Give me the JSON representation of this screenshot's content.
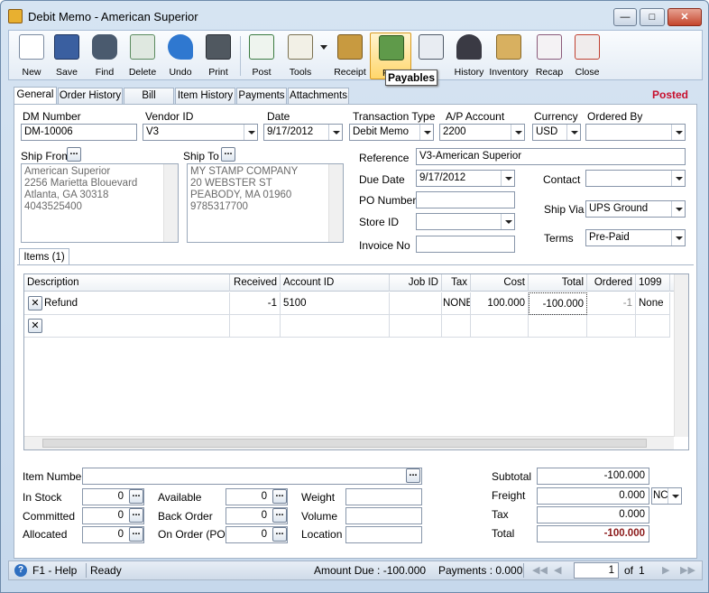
{
  "window": {
    "title": "Debit Memo - American Superior",
    "posted": "Posted"
  },
  "toolbar": {
    "buttons": [
      {
        "label": "New",
        "icon": "new-document-icon"
      },
      {
        "label": "Save",
        "icon": "save-icon"
      },
      {
        "label": "Find",
        "icon": "binoculars-icon"
      },
      {
        "label": "Delete",
        "icon": "recycle-bin-icon"
      },
      {
        "label": "Undo",
        "icon": "undo-icon"
      },
      {
        "label": "Print",
        "icon": "printer-icon"
      },
      {
        "label": "Post",
        "icon": "post-icon"
      },
      {
        "label": "Tools",
        "icon": "tools-icon"
      },
      {
        "label": "Receipt",
        "icon": "receipt-icon"
      },
      {
        "label": "Payables",
        "icon": "payables-icon"
      },
      {
        "label": "",
        "icon": "pen-icon"
      },
      {
        "label": "History",
        "icon": "history-icon"
      },
      {
        "label": "Inventory",
        "icon": "inventory-icon"
      },
      {
        "label": "Recap",
        "icon": "recap-icon"
      },
      {
        "label": "Close",
        "icon": "close-icon"
      }
    ],
    "payables_short": "Pay",
    "tooltip": "Payables"
  },
  "tabs": [
    "General",
    "Order History",
    "Bill History",
    "Item History",
    "Payments",
    "Attachments"
  ],
  "header": {
    "dm_number_label": "DM Number",
    "dm_number": "DM-10006",
    "vendor_id_label": "Vendor ID",
    "vendor_id": "V3",
    "date_label": "Date",
    "date": "9/17/2012",
    "transaction_type_label": "Transaction Type",
    "transaction_type": "Debit Memo",
    "ap_account_label": "A/P Account",
    "ap_account": "2200",
    "currency_label": "Currency",
    "currency": "USD",
    "ordered_by_label": "Ordered By",
    "ordered_by": ""
  },
  "ship_from": {
    "label": "Ship From",
    "lines": [
      "American Superior",
      "2256 Marietta Blouevard",
      "Atlanta, GA 30318",
      "4043525400"
    ]
  },
  "ship_to": {
    "label": "Ship To",
    "lines": [
      "MY STAMP COMPANY",
      "20 WEBSTER ST",
      "PEABODY, MA 01960",
      "9785317700"
    ]
  },
  "details": {
    "reference_label": "Reference",
    "reference": "V3-American Superior",
    "due_date_label": "Due Date",
    "due_date": "9/17/2012",
    "po_number_label": "PO Number",
    "po_number": "",
    "store_id_label": "Store ID",
    "store_id": "",
    "invoice_no_label": "Invoice No",
    "invoice_no": "",
    "contact_label": "Contact",
    "contact": "",
    "ship_via_label": "Ship Via",
    "ship_via": "UPS Ground",
    "terms_label": "Terms",
    "terms": "Pre-Paid"
  },
  "items": {
    "tab_label": "Items (1)",
    "columns": [
      "Description",
      "Received",
      "Account ID",
      "Job ID",
      "Tax",
      "Cost",
      "Total",
      "Ordered",
      "1099"
    ],
    "rows": [
      {
        "description": "Refund",
        "received": "-1",
        "account_id": "5100",
        "job_id": "",
        "tax": "NONE",
        "cost": "100.000",
        "total": "-100.000",
        "ordered": "-1",
        "form_1099": "None"
      }
    ]
  },
  "stock": {
    "item_number_label": "Item Number",
    "item_number": "",
    "in_stock_label": "In Stock",
    "in_stock": "0",
    "committed_label": "Committed",
    "committed": "0",
    "allocated_label": "Allocated",
    "allocated": "0",
    "available_label": "Available",
    "available": "0",
    "back_order_label": "Back Order",
    "back_order": "0",
    "on_order_label": "On Order (PO)",
    "on_order": "0",
    "weight_label": "Weight",
    "weight": "",
    "volume_label": "Volume",
    "volume": "",
    "location_label": "Location",
    "location": ""
  },
  "totals": {
    "subtotal_label": "Subtotal",
    "subtotal": "-100.000",
    "freight_label": "Freight",
    "freight": "0.000",
    "freight_code": "NC",
    "tax_label": "Tax",
    "tax": "0.000",
    "total_label": "Total",
    "total": "-100.000"
  },
  "status": {
    "help": "F1 - Help",
    "state": "Ready",
    "amount_due": "Amount Due : -100.000",
    "payments": "Payments : 0.000",
    "page": "1",
    "of": "of",
    "page_total": "1"
  },
  "colors": {
    "accent_red": "#c8102e",
    "total_red": "#8b1a1a"
  }
}
